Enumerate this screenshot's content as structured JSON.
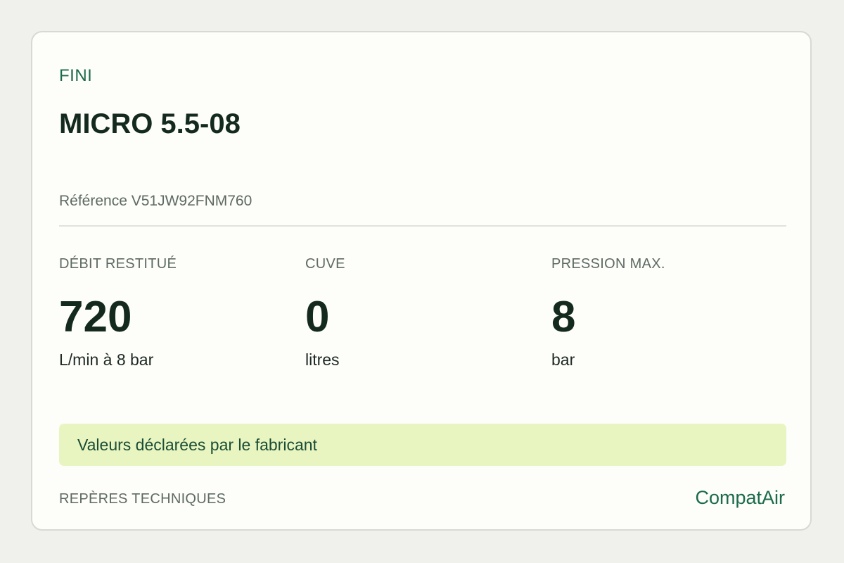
{
  "product": {
    "finish": "FINI",
    "name": "MICRO 5.5-08",
    "reference": "Référence V51JW92FNM760"
  },
  "specs": [
    {
      "label": "DÉBIT RESTITUÉ",
      "value": "720",
      "unit": "L/min à 8 bar"
    },
    {
      "label": "CUVE",
      "value": "0",
      "unit": "litres"
    },
    {
      "label": "PRESSION MAX.",
      "value": "8",
      "unit": "bar"
    }
  ],
  "notice": "Valeurs déclarées par le fabricant",
  "footer": {
    "label": "REPÈRES TECHNIQUES",
    "brand": "CompatAir"
  },
  "colors": {
    "accent": "#1b6b4a",
    "notice_background": "#e9f5c1",
    "page_background": "#f0f0ec",
    "card_background": "#fdfdfa"
  }
}
